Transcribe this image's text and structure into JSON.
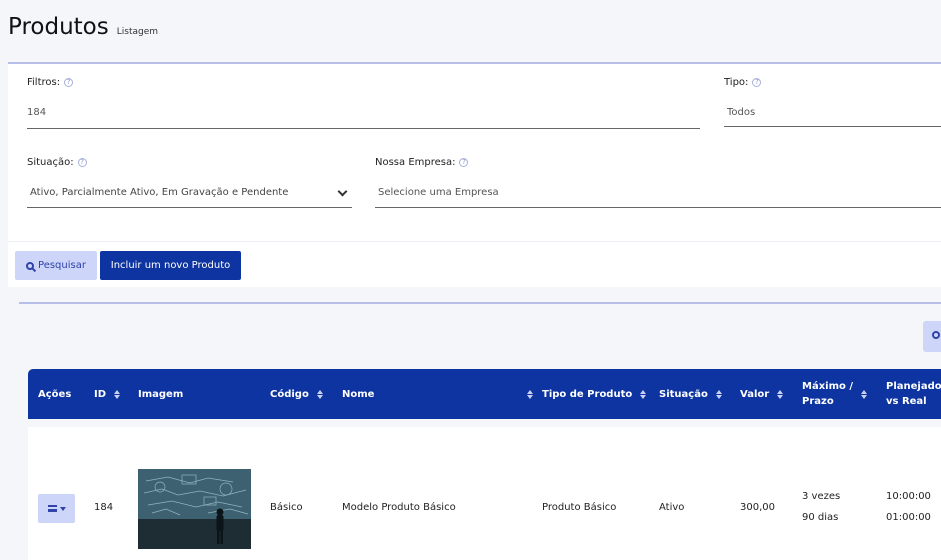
{
  "header": {
    "title": "Produtos",
    "subtitle": "Listagem"
  },
  "filters": {
    "filtros_label": "Filtros:",
    "filtros_value": "184",
    "tipo_label": "Tipo:",
    "tipo_value": "Todos",
    "situacao_label": "Situação:",
    "situacao_value": "Ativo, Parcialmente Ativo, Em Gravação e Pendente",
    "empresa_label": "Nossa Empresa:",
    "empresa_placeholder": "Selecione uma Empresa",
    "help_glyph": "?"
  },
  "buttons": {
    "search_label": "Pesquisar",
    "new_label": "Incluir um novo Produto"
  },
  "table": {
    "headers": {
      "acoes": "Ações",
      "id": "ID",
      "imagem": "Imagem",
      "codigo": "Código",
      "nome": "Nome",
      "tipo": "Tipo de Produto",
      "situacao": "Situação",
      "valor": "Valor",
      "maximo_1": "Máximo /",
      "maximo_2": "Prazo",
      "planejado_1": "Planejado",
      "planejado_2": "vs Real"
    },
    "rows": [
      {
        "id": "184",
        "codigo": "Básico",
        "nome": "Modelo Produto Básico",
        "tipo": "Produto Básico",
        "situacao": "Ativo",
        "valor": "300,00",
        "maximo": "3 vezes",
        "prazo": "90 dias",
        "planejado": "10:00:00",
        "real": "01:00:00"
      }
    ]
  },
  "colors": {
    "primary": "#0d34a0",
    "light_primary": "#cdd5f8",
    "accent_line": "#b7bee8"
  }
}
